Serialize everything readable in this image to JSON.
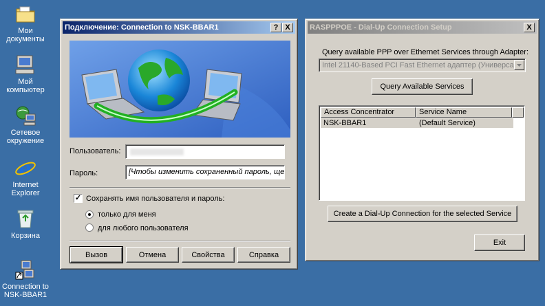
{
  "desktop": {
    "icons": [
      {
        "label1": "Мои",
        "label2": "документы",
        "icon": "folder-icon"
      },
      {
        "label1": "Мой",
        "label2": "компьютер",
        "icon": "computer-icon"
      },
      {
        "label1": "Сетевое",
        "label2": "окружение",
        "icon": "network-icon"
      },
      {
        "label1": "Internet",
        "label2": "Explorer",
        "icon": "ie-icon"
      },
      {
        "label1": "Корзина",
        "label2": "",
        "icon": "recycle-bin-icon"
      },
      {
        "label1": "Connection to",
        "label2": "NSK-BBAR1",
        "icon": "connection-shortcut-icon"
      }
    ]
  },
  "dialup": {
    "title": "Подключение: Connection to NSK-BBAR1",
    "help_btn": "?",
    "close_btn": "X",
    "user_label": "Пользователь:",
    "user_value": "",
    "password_label": "Пароль:",
    "password_value": "[Чтобы изменить сохраненный пароль, щел",
    "save_label": "Сохранять имя пользователя и пароль:",
    "save_checked": "✓",
    "radio_me": "только для меня",
    "radio_any": "для любого пользователя",
    "buttons": {
      "dial": "Вызов",
      "cancel": "Отмена",
      "props": "Свойства",
      "help": "Справка"
    }
  },
  "rasppoe": {
    "title": "RASPPPOE - Dial-Up Connection Setup",
    "close_btn": "X",
    "query_label": "Query available PPP over Ethernet Services through Adapter:",
    "adapter_value": "Intel 21140-Based PCI Fast Ethernet  адаптер (Универсал",
    "query_btn": "Query Available Services",
    "columns": [
      "Access Concentrator",
      "Service Name"
    ],
    "rows": [
      [
        "NSK-BBAR1",
        "(Default Service)"
      ]
    ],
    "create_btn": "Create a Dial-Up Connection for the selected Service",
    "exit_btn": "Exit"
  }
}
